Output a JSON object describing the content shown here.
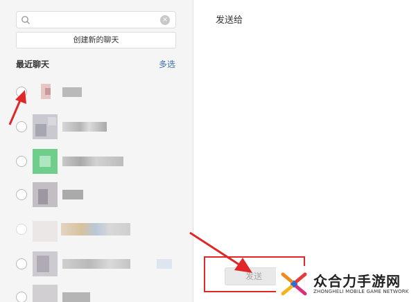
{
  "search": {
    "value": "",
    "placeholder": ""
  },
  "create_chat_label": "创建新的聊天",
  "recent": {
    "title": "最近聊天",
    "multi_select_label": "多选"
  },
  "right": {
    "send_to_title": "发送给",
    "send_label": "发送"
  },
  "watermark": {
    "title": "众合力手游网",
    "subtitle": "ZHONGHELI MOBILE GAME NETWORK"
  },
  "colors": {
    "annotation_red": "#e02626",
    "multi_select_blue": "#3b6fb0"
  }
}
